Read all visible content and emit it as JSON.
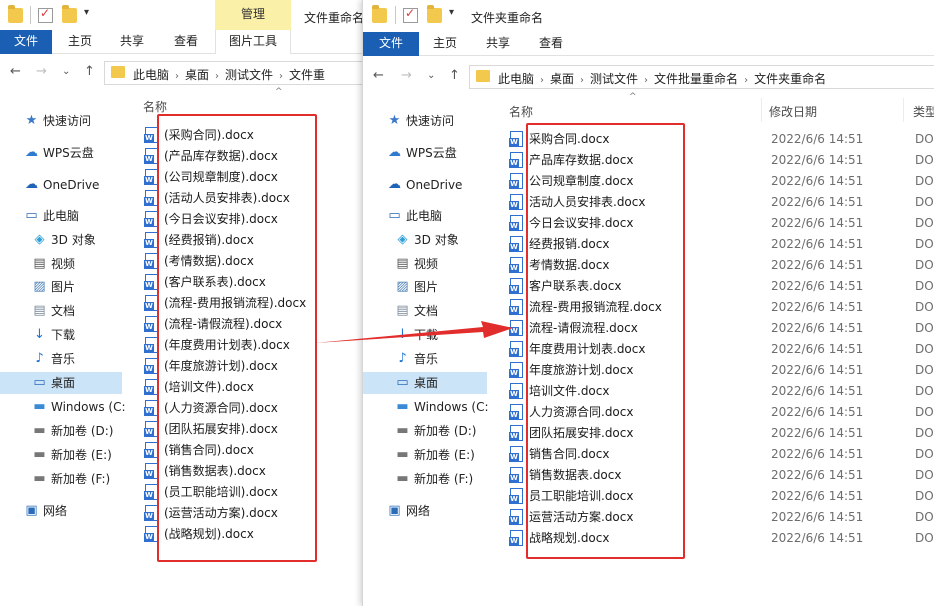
{
  "left_window": {
    "title": "文件重命名",
    "ribbon": {
      "file": "文件",
      "home": "主页",
      "share": "共享",
      "view": "查看",
      "picture_tools": "图片工具",
      "manage": "管理"
    },
    "address": [
      "此电脑",
      "桌面",
      "测试文件",
      "文件重"
    ],
    "column_name": "名称",
    "nav": {
      "quick_access": "快速访问",
      "wps": "WPS云盘",
      "onedrive": "OneDrive",
      "this_pc": "此电脑",
      "objects3d": "3D 对象",
      "videos": "视频",
      "pictures": "图片",
      "documents": "文档",
      "downloads": "下载",
      "music": "音乐",
      "desktop": "桌面",
      "windows": "Windows (C:",
      "drive_d": "新加卷 (D:)",
      "drive_e": "新加卷 (E:)",
      "drive_f": "新加卷 (F:)",
      "network": "网络"
    },
    "files": [
      "(采购合同).docx",
      "(产品库存数据).docx",
      "(公司规章制度).docx",
      "(活动人员安排表).docx",
      "(今日会议安排).docx",
      "(经费报销).docx",
      "(考情数据).docx",
      "(客户联系表).docx",
      "(流程-费用报销流程).docx",
      "(流程-请假流程).docx",
      "(年度费用计划表).docx",
      "(年度旅游计划).docx",
      "(培训文件).docx",
      "(人力资源合同).docx",
      "(团队拓展安排).docx",
      "(销售合同).docx",
      "(销售数据表).docx",
      "(员工职能培训).docx",
      "(运营活动方案).docx",
      "(战略规划).docx"
    ]
  },
  "right_window": {
    "title": "文件夹重命名",
    "ribbon": {
      "file": "文件",
      "home": "主页",
      "share": "共享",
      "view": "查看"
    },
    "address": [
      "此电脑",
      "桌面",
      "测试文件",
      "文件批量重命名",
      "文件夹重命名"
    ],
    "column_name": "名称",
    "column_modified": "修改日期",
    "column_type": "类型",
    "nav": {
      "quick_access": "快速访问",
      "wps": "WPS云盘",
      "onedrive": "OneDrive",
      "this_pc": "此电脑",
      "objects3d": "3D 对象",
      "videos": "视频",
      "pictures": "图片",
      "documents": "文档",
      "downloads": "下载",
      "music": "音乐",
      "desktop": "桌面",
      "windows": "Windows (C:",
      "drive_d": "新加卷 (D:)",
      "drive_e": "新加卷 (E:)",
      "drive_f": "新加卷 (F:)",
      "network": "网络"
    },
    "files": [
      {
        "name": "采购合同.docx",
        "date": "2022/6/6 14:51",
        "type": "DO"
      },
      {
        "name": "产品库存数据.docx",
        "date": "2022/6/6 14:51",
        "type": "DO"
      },
      {
        "name": "公司规章制度.docx",
        "date": "2022/6/6 14:51",
        "type": "DO"
      },
      {
        "name": "活动人员安排表.docx",
        "date": "2022/6/6 14:51",
        "type": "DO"
      },
      {
        "name": "今日会议安排.docx",
        "date": "2022/6/6 14:51",
        "type": "DO"
      },
      {
        "name": "经费报销.docx",
        "date": "2022/6/6 14:51",
        "type": "DO"
      },
      {
        "name": "考情数据.docx",
        "date": "2022/6/6 14:51",
        "type": "DO"
      },
      {
        "name": "客户联系表.docx",
        "date": "2022/6/6 14:51",
        "type": "DO"
      },
      {
        "name": "流程-费用报销流程.docx",
        "date": "2022/6/6 14:51",
        "type": "DO"
      },
      {
        "name": "流程-请假流程.docx",
        "date": "2022/6/6 14:51",
        "type": "DO"
      },
      {
        "name": "年度费用计划表.docx",
        "date": "2022/6/6 14:51",
        "type": "DO"
      },
      {
        "name": "年度旅游计划.docx",
        "date": "2022/6/6 14:51",
        "type": "DO"
      },
      {
        "name": "培训文件.docx",
        "date": "2022/6/6 14:51",
        "type": "DO"
      },
      {
        "name": "人力资源合同.docx",
        "date": "2022/6/6 14:51",
        "type": "DO"
      },
      {
        "name": "团队拓展安排.docx",
        "date": "2022/6/6 14:51",
        "type": "DO"
      },
      {
        "name": "销售合同.docx",
        "date": "2022/6/6 14:51",
        "type": "DO"
      },
      {
        "name": "销售数据表.docx",
        "date": "2022/6/6 14:51",
        "type": "DO"
      },
      {
        "name": "员工职能培训.docx",
        "date": "2022/6/6 14:51",
        "type": "DO"
      },
      {
        "name": "运营活动方案.docx",
        "date": "2022/6/6 14:51",
        "type": "DO"
      },
      {
        "name": "战略规划.docx",
        "date": "2022/6/6 14:51",
        "type": "DO"
      }
    ]
  },
  "colors": {
    "accent": "#1a5fb4",
    "highlight": "#e22d2d",
    "selected_nav": "#cce4f7",
    "context_tab": "#fbf0a8"
  }
}
